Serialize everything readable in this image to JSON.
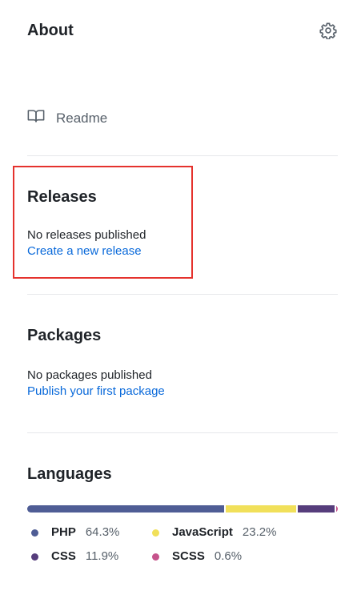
{
  "about": {
    "title": "About",
    "settings_icon": "gear-icon",
    "readme_label": "Readme",
    "readme_icon": "book-icon"
  },
  "releases": {
    "title": "Releases",
    "status": "No releases published",
    "link": "Create a new release",
    "highlight_color": "#e5322d"
  },
  "packages": {
    "title": "Packages",
    "status": "No packages published",
    "link": "Publish your first package"
  },
  "languages": {
    "title": "Languages",
    "items": [
      {
        "name": "PHP",
        "percent": "64.3%",
        "value": 64.3,
        "color": "#4f5d95"
      },
      {
        "name": "JavaScript",
        "percent": "23.2%",
        "value": 23.2,
        "color": "#f1e05a"
      },
      {
        "name": "CSS",
        "percent": "11.9%",
        "value": 11.9,
        "color": "#563d7c"
      },
      {
        "name": "SCSS",
        "percent": "0.6%",
        "value": 0.6,
        "color": "#c6538c"
      }
    ]
  }
}
